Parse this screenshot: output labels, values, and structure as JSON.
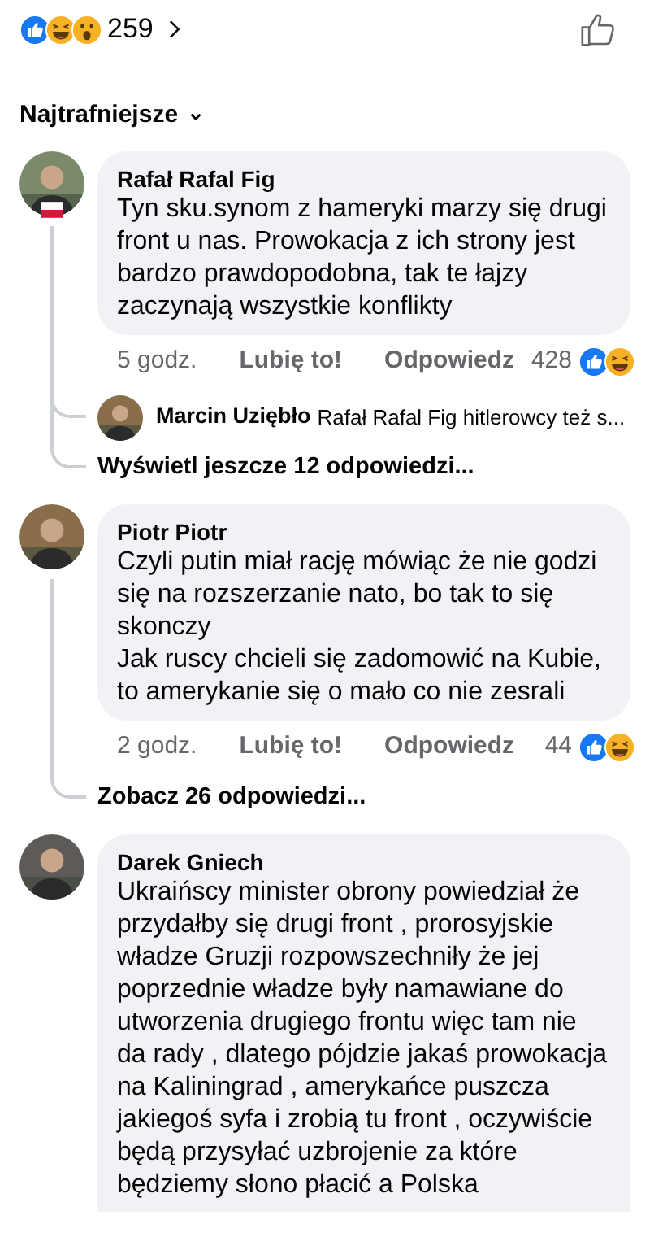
{
  "header": {
    "reactions": [
      {
        "kind": "like"
      },
      {
        "kind": "haha"
      },
      {
        "kind": "wow"
      }
    ],
    "count": "259"
  },
  "sort": {
    "label": "Najtrafniejsze"
  },
  "comments": [
    {
      "author": "Rafał Rafal Fig",
      "flag_badge": true,
      "text": "Tyn sku.synom z hameryki marzy się drugi front u nas. Prowokacja z ich strony jest bardzo prawdopodobna, tak te łajzy zaczynają wszystkie konflikty",
      "time": "5 godz.",
      "like_action": "Lubię to!",
      "reply_action": "Odpowiedz",
      "reaction_count": "428",
      "reactions": [
        {
          "kind": "like"
        },
        {
          "kind": "haha"
        }
      ],
      "replies": [
        {
          "author": "Marcin Uziębło",
          "text": "Rafał Rafal Fig hitlerowcy też s..."
        }
      ],
      "more_replies": "Wyświetl jeszcze 12 odpowiedzi..."
    },
    {
      "author": "Piotr Piotr",
      "text": "Czyli putin miał rację mówiąc że nie godzi się na rozszerzanie nato, bo tak to się skonczy\nJak ruscy chcieli się zadomowić na Kubie, to amerykanie się o mało co nie zesrali",
      "time": "2 godz.",
      "like_action": "Lubię to!",
      "reply_action": "Odpowiedz",
      "reaction_count": "44",
      "reactions": [
        {
          "kind": "like"
        },
        {
          "kind": "haha"
        }
      ],
      "more_replies": "Zobacz 26 odpowiedzi..."
    },
    {
      "author": "Darek Gniech",
      "text": "Ukraińscy minister obrony powiedział że przydałby się drugi front , prorosyjskie władze Gruzji rozpowszechniły że jej poprzednie władze były namawiane do utworzenia drugiego frontu więc tam nie da rady , dlatego pójdzie jakaś prowokacja na Kaliningrad , amerykańce puszcza jakiegoś syfa i zrobią tu front , oczywiście będą przysyłać uzbrojenie za które będziemy słono płacić a Polska"
    }
  ]
}
